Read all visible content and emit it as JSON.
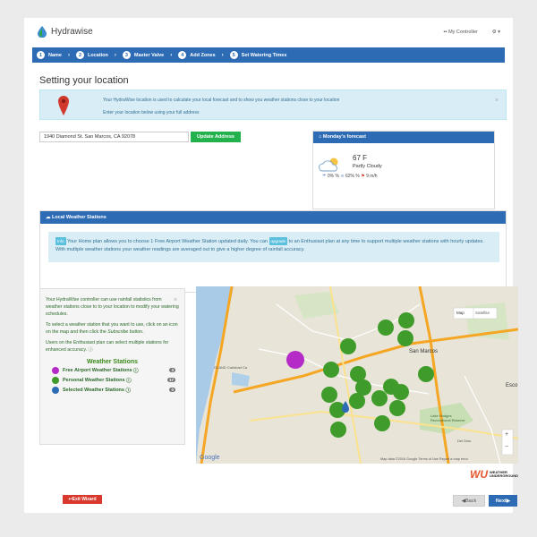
{
  "header": {
    "brand": "Hydrawise",
    "controller_label": "My Controller",
    "settings_label": "⚙ ▾"
  },
  "wizard": {
    "steps": [
      {
        "num": "1",
        "label": "Name"
      },
      {
        "num": "2",
        "label": "Location"
      },
      {
        "num": "3",
        "label": "Master Valve"
      },
      {
        "num": "4",
        "label": "Add Zones"
      },
      {
        "num": "5",
        "label": "Set Watering Times"
      }
    ]
  },
  "page_title": "Setting your location",
  "info": {
    "line1": "Your HydraWise location is used to calculate your local forecast and to show you weather stations close to your location",
    "line2": "Enter your location below using your full address"
  },
  "address": {
    "value": "1940 Diamond St. San Marcos, CA 92078",
    "button": "Update Address"
  },
  "forecast": {
    "header": "Monday's forecast",
    "temp": "67 F",
    "condition": "Partly Cloudy",
    "precip": "0%",
    "humidity_sep": "%",
    "humidity": "62%",
    "wind": "9 m/h"
  },
  "lws": {
    "header": "Local Weather Stations",
    "tag_info": "Info",
    "text1": "Your Home plan allows you to choose 1 Free Airport Weather Station updated daily. You can",
    "tag_upgrade": "upgrade",
    "text2": "to an Enthusiast plan at any time to support multiple weather stations with hourly updates. With multiple weather stations your weather readings are averaged out to give a higher degree of rainfall accuracy."
  },
  "sidebar": {
    "p1": "Your HydraWise controller can use rainfall statistics from weather stations close to to your location to modify your watering schedules.",
    "p2a": "To select a weather station that you want to use, click on an icon on the map and then click the",
    "p2b": "Subscribe",
    "p2c": "button.",
    "p3": "Users on the Enthusiast plan can select multiple stations for enhanced accuracy.",
    "title": "Weather Stations",
    "rows": [
      {
        "label": "Free Airport Weather Stations",
        "count": "3",
        "color": "#b52bc8"
      },
      {
        "label": "Personal Weather Stations",
        "count": "17",
        "color": "#3f9c2a"
      },
      {
        "label": "Selected Weather Stations",
        "count": "0",
        "color": "#2d6bb5"
      }
    ]
  },
  "map": {
    "map_label": "Map",
    "satellite_label": "Satellite",
    "google": "Google",
    "attribution": "Map data ©2016 Google   Terms of Use   Report a map error",
    "labels": {
      "san_marcos": "San Marcos",
      "esco": "Esco",
      "carlsbad": "OLAND Carlsbad Ca",
      "lake": "Lake Hodges Recreational Reserve",
      "deldios": "Del Dios",
      "zoom_in": "+",
      "zoom_out": "−"
    }
  },
  "wu": {
    "line1": "WEATHER",
    "line2": "UNDERGROUND"
  },
  "buttons": {
    "exit": "Exit Wizard",
    "back": "Back",
    "next": "Next"
  }
}
